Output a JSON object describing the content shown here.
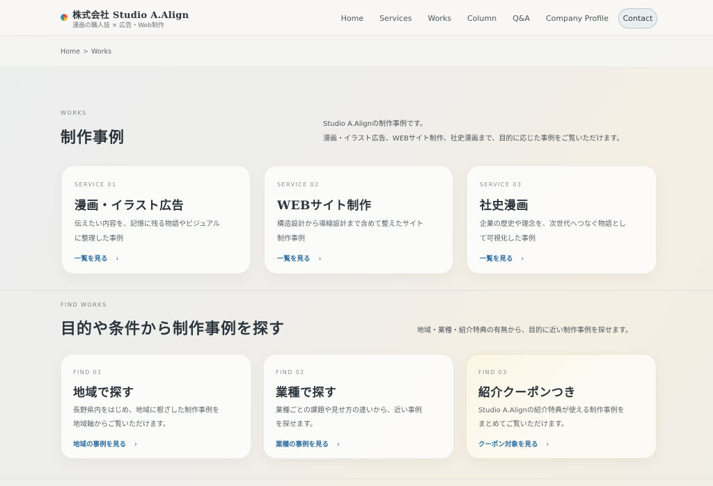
{
  "header": {
    "brand_name": "株式会社 Studio A.Align",
    "brand_tagline": "漫画の職人技 × 広告・Web制作",
    "nav": [
      "Home",
      "Services",
      "Works",
      "Column",
      "Q&A",
      "Company Profile"
    ],
    "contact_label": "Contact"
  },
  "breadcrumb": {
    "home": "Home",
    "separator": ">",
    "current": "Works"
  },
  "works": {
    "kicker": "WORKS",
    "title": "制作事例",
    "lead_1": "Studio A.Alignの制作事例です。",
    "lead_2": "漫画・イラスト広告、WEBサイト制作、社史漫画まで、目的に応じた事例をご覧いただけます。",
    "cards": [
      {
        "kicker": "SERVICE 01",
        "title": "漫画・イラスト広告",
        "desc_1": "伝えたい内容を、記憶に残る物語やビジュアル",
        "desc_2": "に整理した事例",
        "link": "一覧を見る",
        "arrow": "›"
      },
      {
        "kicker": "SERVICE 02",
        "title": "WEBサイト制作",
        "desc_1": "構造設計から導線設計まで含めて整えたサイト",
        "desc_2": "制作事例",
        "link": "一覧を見る",
        "arrow": "›"
      },
      {
        "kicker": "SERVICE 03",
        "title": "社史漫画",
        "desc_1": "企業の歴史や理念を、次世代へつなぐ物語とし",
        "desc_2": "て可視化した事例",
        "link": "一覧を見る",
        "arrow": "›"
      }
    ]
  },
  "find": {
    "kicker": "FIND WORKS",
    "title": "目的や条件から制作事例を探す",
    "lead": "地域・業種・紹介特典の有無から、目的に近い制作事例を探せます。",
    "cards": [
      {
        "kicker": "FIND 01",
        "title": "地域で探す",
        "desc_1": "長野県内をはじめ、地域に根ざした制作事例を",
        "desc_2": "地域軸からご覧いただけます。",
        "link": "地域の事例を見る",
        "arrow": "›"
      },
      {
        "kicker": "FIND 02",
        "title": "業種で探す",
        "desc_1": "業種ごとの課題や見せ方の違いから、近い事例",
        "desc_2": "を探せます。",
        "link": "業種の事例を見る",
        "arrow": "›"
      },
      {
        "kicker": "FIND 03",
        "title": "紹介クーポンつき",
        "desc_1": "Studio A.Alignの紹介特典が使える制作事例を",
        "desc_2": "まとめてご覧いただけます。",
        "link": "クーポン対象を見る",
        "arrow": "›"
      }
    ]
  }
}
